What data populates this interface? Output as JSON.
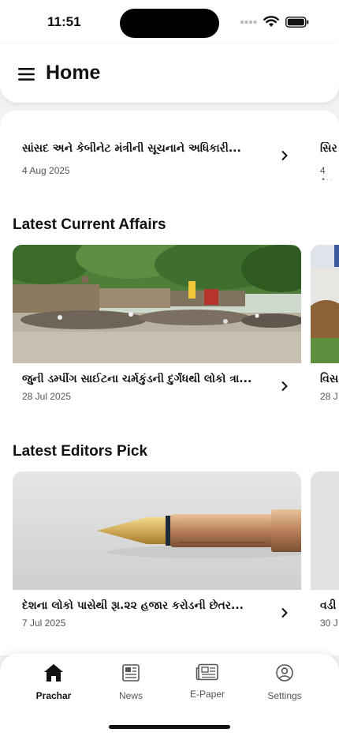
{
  "status_bar": {
    "time": "11:51"
  },
  "header": {
    "title": "Home"
  },
  "top_cards": [
    {
      "title": "સાંસદ અને કેબીનેટ મંત્રીની સૂચનાને અધિકારી...",
      "date": "4 Aug 2025"
    },
    {
      "title": "સિર",
      "date": "4 Au"
    }
  ],
  "sections": [
    {
      "title": "Latest Current Affairs",
      "card": {
        "title": "જુની ડમ્પીંગ સાઈટના ચર્મકુંડની દુર્ગંધથી લોકો ત્રા...",
        "date": "28 Jul 2025"
      },
      "peek": {
        "title": "વિસ",
        "date": "28 J"
      }
    },
    {
      "title": "Latest Editors Pick",
      "card": {
        "title": "દેશના લોકો પાસેથી રૂા.૨૨ હજાર કરોડની છેતર...",
        "date": "7 Jul 2025"
      },
      "peek": {
        "title": "વડી",
        "date": "30 J"
      }
    }
  ],
  "bottom_nav": {
    "items": [
      {
        "label": "Prachar",
        "icon": "home-icon",
        "active": true
      },
      {
        "label": "News",
        "icon": "news-icon",
        "active": false
      },
      {
        "label": "E-Paper",
        "icon": "epaper-icon",
        "active": false
      },
      {
        "label": "Settings",
        "icon": "settings-icon",
        "active": false
      }
    ]
  }
}
